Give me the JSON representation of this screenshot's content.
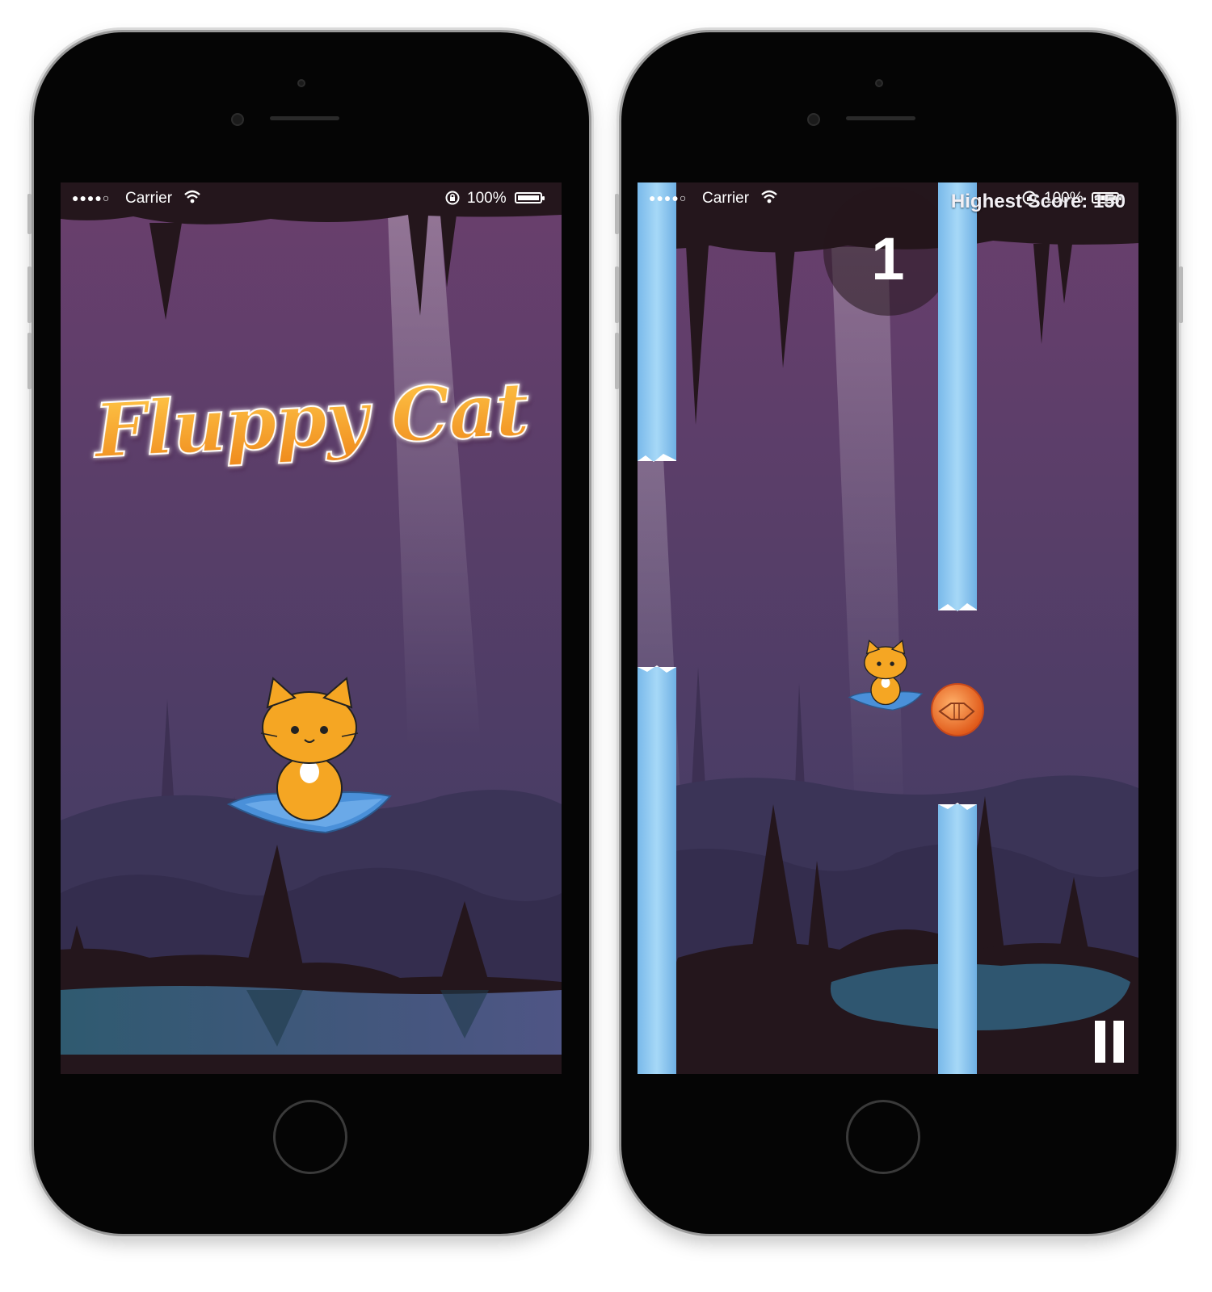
{
  "screens": {
    "left": {
      "status_bar": {
        "signal": "●●●●○",
        "carrier": "Carrier",
        "battery": "100%"
      },
      "title": "Fluppy Cat"
    },
    "right": {
      "status_bar": {
        "signal": "●●●●○",
        "carrier": "Carrier",
        "battery": "100%"
      },
      "score": "1",
      "highest_score_label": "Highest Score: 150"
    }
  },
  "icons": {
    "wifi": "wifi-icon",
    "lock": "rotation-lock-icon",
    "battery": "battery-icon",
    "pause": "pause-icon",
    "coin": "fish-coin-icon"
  },
  "colors": {
    "cave_top": "#6a3f6d",
    "cave_bottom": "#3f3b63",
    "cave_rock": "#2a1a1f",
    "water": "#35596f",
    "pipe": "#8cc9f2",
    "cat": "#f5a623",
    "carpet": "#4a90d9",
    "title_orange": "#f4a328"
  }
}
